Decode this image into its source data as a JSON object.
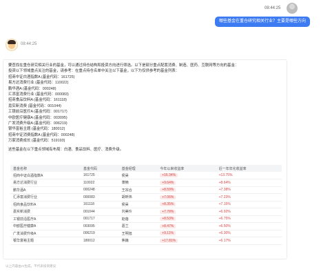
{
  "header": {
    "time": "08:44:25"
  },
  "user_message": {
    "text": "哪些基金在重仓研究相关行业？主要是哪些方向"
  },
  "bot": {
    "time": "08:44:25"
  },
  "reply": {
    "intro": "要查找在重仓研究相关行业的基金，可以通过持仓结构和投资方向进行筛选。以下是部分重点配置消费、制造、医药、互联网等方向的基金：",
    "intro2": "投资以下领域重点关注的基金，请参考：在重点持仓名单中关注以下基金，以下为仅供参考的基金列表：",
    "funds": [
      "招商中证白酒指数A (基金代码：161725)",
      "易方达消费行业 (基金代码：110022)",
      "鹏华酒A (基金代码：000248)",
      "汇添富消费行业 (基金代码：000083)",
      "招商食品饮料A (基金代码：161118)",
      "嘉实新消费 (基金代码：001044)",
      "工银前沿医疗A (基金代码：001717)",
      "中欧医疗健康A (基金代码：003095)",
      "广发消费升级A (基金代码：006219)",
      "银华富裕主题 (基金代码：180012)",
      "招商中证消费指数A (基金代码：000248)",
      "万家消费成长 (基金代码：519193)"
    ],
    "summary": "这些基金在以下重点领域有布局：白酒、食品饮料、医疗、消费升级。"
  },
  "table": {
    "headers": [
      "基金名称",
      "基金代码",
      "基金经理",
      "今年以来收益率",
      "近一年年化收益率"
    ],
    "rows": [
      [
        "招商中证白酒指数A",
        "161725",
        "侯昊",
        "+16.34%",
        "+13.75%"
      ],
      [
        "易方达消费行业",
        "110022",
        "萧楠",
        "+9.64%",
        "+8.64%"
      ],
      [
        "鹏华酒A",
        "000248",
        "王宗合",
        "+8.59%",
        "+7.38%"
      ],
      [
        "汇添富消费行业",
        "000083",
        "胡昕炜",
        "+7.06%",
        "+7.23%"
      ],
      [
        "招商食品饮料A",
        "161118",
        "侯昊",
        "+8.35%",
        "+7.15%"
      ],
      [
        "嘉实新消费",
        "001044",
        "刘美玲",
        "+7.78%",
        "+6.92%"
      ],
      [
        "工银前沿医疗A",
        "001717",
        "赵蓓",
        "+8.53%",
        "+6.75%"
      ],
      [
        "中欧医疗健康A",
        "003095",
        "葛兰",
        "+8.47%",
        "+6.50%"
      ],
      [
        "广发消费升级A",
        "006219",
        "王明旭",
        "+9.11%",
        "+6.30%"
      ],
      [
        "银华富裕主题",
        "180012",
        "焦巍",
        "+17.81%",
        "+6.17%"
      ]
    ]
  },
  "footer": {
    "note": "以上内容由AI生成，不代表投资建议"
  }
}
